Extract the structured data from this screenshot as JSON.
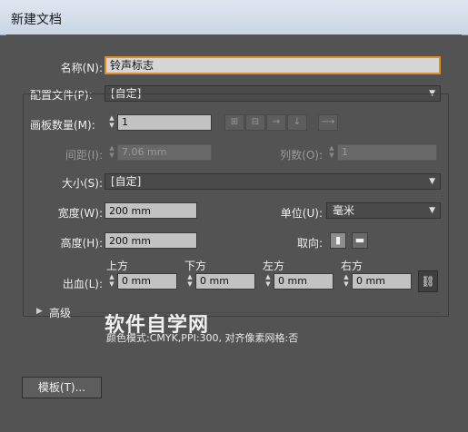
{
  "window": {
    "title": "新建文档"
  },
  "name": {
    "label": "名称(N):",
    "value": "铃声标志"
  },
  "profile": {
    "label": "配置文件(P):",
    "value": "[自定]"
  },
  "artboards": {
    "count_label": "画板数量(M):",
    "count_value": "1",
    "spacing_label": "间距(I):",
    "spacing_value": "7.06 mm",
    "columns_label": "列数(O):",
    "columns_value": "1",
    "layout_icons": [
      "grid-by-row-icon",
      "grid-by-column-icon",
      "arrange-by-row-icon",
      "arrange-by-column-icon"
    ],
    "direction_icon": "right-to-left-arrow-icon"
  },
  "size": {
    "label": "大小(S):",
    "value": "[自定]"
  },
  "width": {
    "label": "宽度(W):",
    "value": "200 mm"
  },
  "height": {
    "label": "高度(H):",
    "value": "200 mm"
  },
  "units": {
    "label": "单位(U):",
    "value": "毫米"
  },
  "orientation": {
    "label": "取向:",
    "icons": [
      "portrait-icon",
      "landscape-icon"
    ]
  },
  "bleed": {
    "label": "出血(L):",
    "top_label": "上方",
    "top_value": "0 mm",
    "bottom_label": "下方",
    "bottom_value": "0 mm",
    "left_label": "左方",
    "left_value": "0 mm",
    "right_label": "右方",
    "right_value": "0 mm"
  },
  "advanced": {
    "label": "高级",
    "info": "颜色模式:CMYK,PPI:300, 对齐像素网格:否"
  },
  "template_button": "模板(T)...",
  "watermark": "软件自学网"
}
